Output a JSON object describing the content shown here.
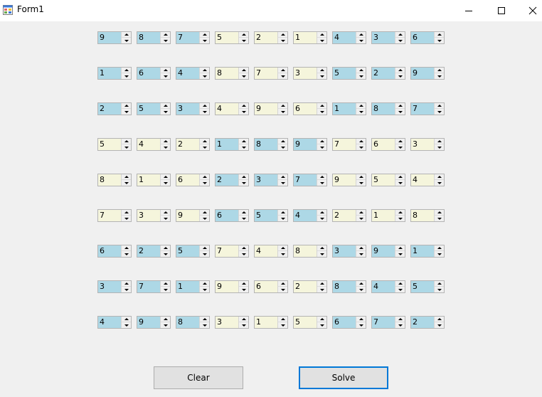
{
  "window": {
    "title": "Form1"
  },
  "colors": {
    "blue_cell": "#add8e6",
    "beige_cell": "#f5f5dc"
  },
  "grid": {
    "rows": [
      [
        {
          "v": "9",
          "c": "blue"
        },
        {
          "v": "8",
          "c": "blue"
        },
        {
          "v": "7",
          "c": "blue"
        },
        {
          "v": "5",
          "c": "beige"
        },
        {
          "v": "2",
          "c": "beige"
        },
        {
          "v": "1",
          "c": "beige"
        },
        {
          "v": "4",
          "c": "blue"
        },
        {
          "v": "3",
          "c": "blue"
        },
        {
          "v": "6",
          "c": "blue"
        }
      ],
      [
        {
          "v": "1",
          "c": "blue"
        },
        {
          "v": "6",
          "c": "blue"
        },
        {
          "v": "4",
          "c": "blue"
        },
        {
          "v": "8",
          "c": "beige"
        },
        {
          "v": "7",
          "c": "beige"
        },
        {
          "v": "3",
          "c": "beige"
        },
        {
          "v": "5",
          "c": "blue"
        },
        {
          "v": "2",
          "c": "blue"
        },
        {
          "v": "9",
          "c": "blue"
        }
      ],
      [
        {
          "v": "2",
          "c": "blue"
        },
        {
          "v": "5",
          "c": "blue"
        },
        {
          "v": "3",
          "c": "blue"
        },
        {
          "v": "4",
          "c": "beige"
        },
        {
          "v": "9",
          "c": "beige"
        },
        {
          "v": "6",
          "c": "beige"
        },
        {
          "v": "1",
          "c": "blue"
        },
        {
          "v": "8",
          "c": "blue"
        },
        {
          "v": "7",
          "c": "blue"
        }
      ],
      [
        {
          "v": "5",
          "c": "beige"
        },
        {
          "v": "4",
          "c": "beige"
        },
        {
          "v": "2",
          "c": "beige"
        },
        {
          "v": "1",
          "c": "blue"
        },
        {
          "v": "8",
          "c": "blue"
        },
        {
          "v": "9",
          "c": "blue"
        },
        {
          "v": "7",
          "c": "beige"
        },
        {
          "v": "6",
          "c": "beige"
        },
        {
          "v": "3",
          "c": "beige"
        }
      ],
      [
        {
          "v": "8",
          "c": "beige"
        },
        {
          "v": "1",
          "c": "beige"
        },
        {
          "v": "6",
          "c": "beige"
        },
        {
          "v": "2",
          "c": "blue"
        },
        {
          "v": "3",
          "c": "blue"
        },
        {
          "v": "7",
          "c": "blue"
        },
        {
          "v": "9",
          "c": "beige"
        },
        {
          "v": "5",
          "c": "beige"
        },
        {
          "v": "4",
          "c": "beige"
        }
      ],
      [
        {
          "v": "7",
          "c": "beige"
        },
        {
          "v": "3",
          "c": "beige"
        },
        {
          "v": "9",
          "c": "beige"
        },
        {
          "v": "6",
          "c": "blue"
        },
        {
          "v": "5",
          "c": "blue"
        },
        {
          "v": "4",
          "c": "blue"
        },
        {
          "v": "2",
          "c": "beige"
        },
        {
          "v": "1",
          "c": "beige"
        },
        {
          "v": "8",
          "c": "beige"
        }
      ],
      [
        {
          "v": "6",
          "c": "blue"
        },
        {
          "v": "2",
          "c": "blue"
        },
        {
          "v": "5",
          "c": "blue"
        },
        {
          "v": "7",
          "c": "beige"
        },
        {
          "v": "4",
          "c": "beige"
        },
        {
          "v": "8",
          "c": "beige"
        },
        {
          "v": "3",
          "c": "blue"
        },
        {
          "v": "9",
          "c": "blue"
        },
        {
          "v": "1",
          "c": "blue"
        }
      ],
      [
        {
          "v": "3",
          "c": "blue"
        },
        {
          "v": "7",
          "c": "blue"
        },
        {
          "v": "1",
          "c": "blue"
        },
        {
          "v": "9",
          "c": "beige"
        },
        {
          "v": "6",
          "c": "beige"
        },
        {
          "v": "2",
          "c": "beige"
        },
        {
          "v": "8",
          "c": "blue"
        },
        {
          "v": "4",
          "c": "blue"
        },
        {
          "v": "5",
          "c": "blue"
        }
      ],
      [
        {
          "v": "4",
          "c": "blue"
        },
        {
          "v": "9",
          "c": "blue"
        },
        {
          "v": "8",
          "c": "blue"
        },
        {
          "v": "3",
          "c": "beige"
        },
        {
          "v": "1",
          "c": "beige"
        },
        {
          "v": "5",
          "c": "beige"
        },
        {
          "v": "6",
          "c": "blue"
        },
        {
          "v": "7",
          "c": "blue"
        },
        {
          "v": "2",
          "c": "blue"
        }
      ]
    ]
  },
  "buttons": {
    "clear_label": "Clear",
    "solve_label": "Solve"
  }
}
